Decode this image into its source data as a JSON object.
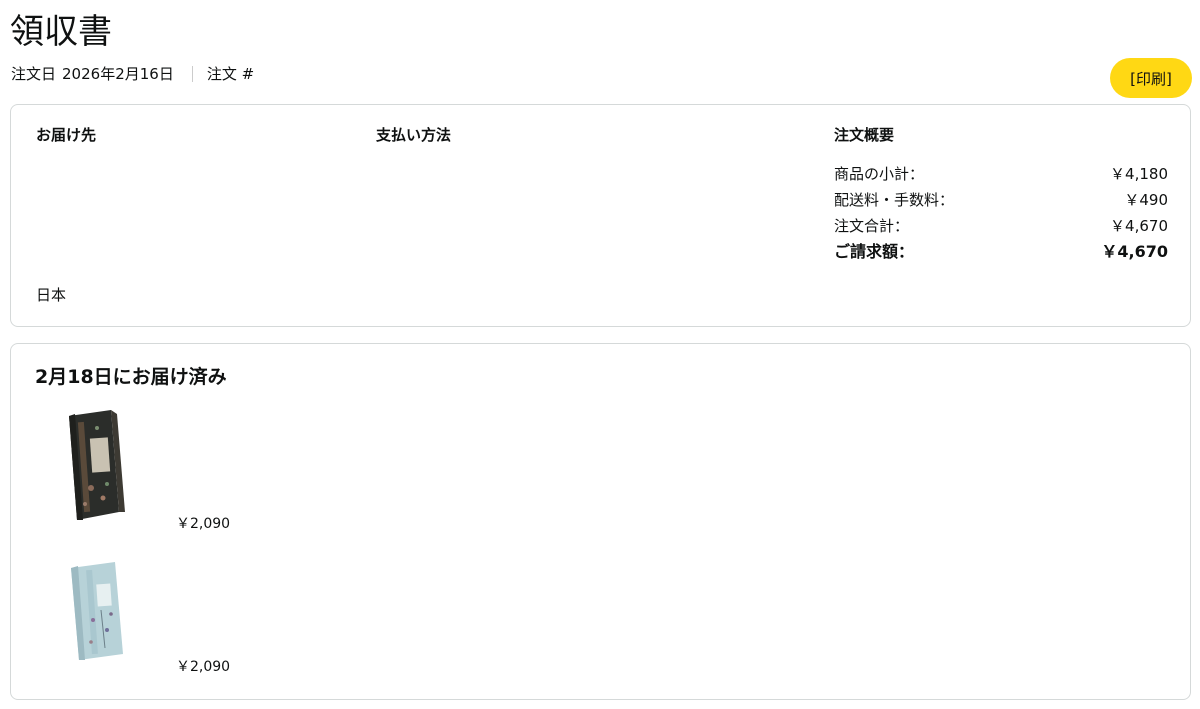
{
  "page": {
    "title": "領収書",
    "order_date_label": "注文日",
    "order_date": "2026年2月16日",
    "order_number_label": "注文 #",
    "print_label": "[印刷]"
  },
  "summary": {
    "shipping_heading": "お届け先",
    "payment_heading": "支払い方法",
    "order_summary_heading": "注文概要",
    "country": "日本",
    "rows": [
      {
        "label": "商品の小計：",
        "value": "￥4,180"
      },
      {
        "label": "配送料・手数料：",
        "value": "￥490"
      },
      {
        "label": "注文合計：",
        "value": "￥4,670"
      },
      {
        "label": "ご請求額：",
        "value": "￥4,670"
      }
    ]
  },
  "delivery": {
    "heading": "2月18日にお届け済み",
    "items": [
      {
        "price": "￥2,090",
        "icon": "dark-floral-book-box"
      },
      {
        "price": "￥2,090",
        "icon": "light-blue-floral-book-box"
      }
    ]
  },
  "colors": {
    "print_button": "#ffd814",
    "card_border": "#d5d9d9",
    "text": "#0f1111"
  }
}
